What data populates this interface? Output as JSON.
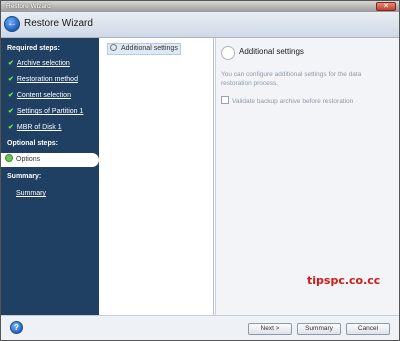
{
  "window": {
    "title": "Restore Wizard"
  },
  "header": {
    "title": "Restore Wizard"
  },
  "sidebar": {
    "required_label": "Required steps:",
    "steps": [
      {
        "label": "Archive selection"
      },
      {
        "label": "Restoration method"
      },
      {
        "label": "Content selection"
      },
      {
        "label": "Settings of Partition 1"
      },
      {
        "label": "MBR of Disk 1"
      }
    ],
    "optional_label": "Optional steps:",
    "optional_item": "Options",
    "summary_label": "Summary:",
    "summary_link": "Summary"
  },
  "tree": {
    "item": "Additional settings"
  },
  "panel": {
    "title": "Additional settings",
    "description": "You can configure additional settings for the data restoration process.",
    "checkbox_label": "Validate backup archive before restoration",
    "watermark": "tipspc.co.cc"
  },
  "footer": {
    "next": "Next >",
    "summary": "Summary",
    "cancel": "Cancel"
  }
}
